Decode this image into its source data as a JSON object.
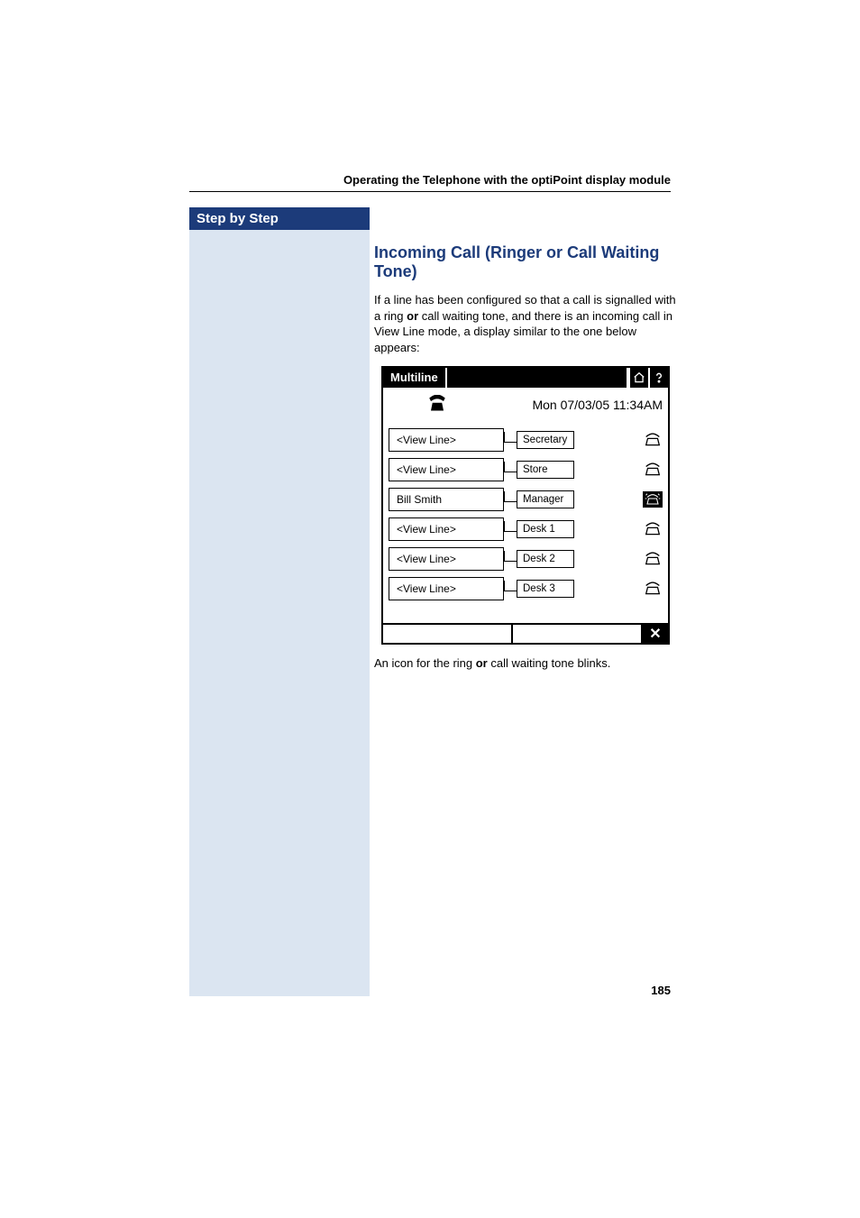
{
  "header": {
    "running_title": "Operating the Telephone with the optiPoint display module"
  },
  "sidebar": {
    "header": "Step by Step"
  },
  "body": {
    "heading": "Incoming Call (Ringer or Call Waiting Tone)",
    "intro_pre": "If a line has been configured so that a call is signalled with a ring ",
    "intro_bold1": "or",
    "intro_post": " call waiting tone, and there is an incoming call in View Line mode, a display similar to the one below appears:",
    "after_pre": "An icon for the ring ",
    "after_bold": "or",
    "after_post": " call waiting tone blinks."
  },
  "phone": {
    "title": "Multiline",
    "datetime": "Mon 07/03/05 11:34AM",
    "close_label": "✕",
    "lines": [
      {
        "left": "<View Line>",
        "right": "Secretary",
        "icon": "phone-idle"
      },
      {
        "left": "<View Line>",
        "right": "Store",
        "icon": "phone-idle"
      },
      {
        "left": "Bill Smith",
        "right": "Manager",
        "icon": "phone-ringing"
      },
      {
        "left": "<View Line>",
        "right": "Desk 1",
        "icon": "phone-idle"
      },
      {
        "left": "<View Line>",
        "right": "Desk 2",
        "icon": "phone-idle"
      },
      {
        "left": "<View Line>",
        "right": "Desk 3",
        "icon": "phone-idle"
      }
    ]
  },
  "page_number": "185"
}
